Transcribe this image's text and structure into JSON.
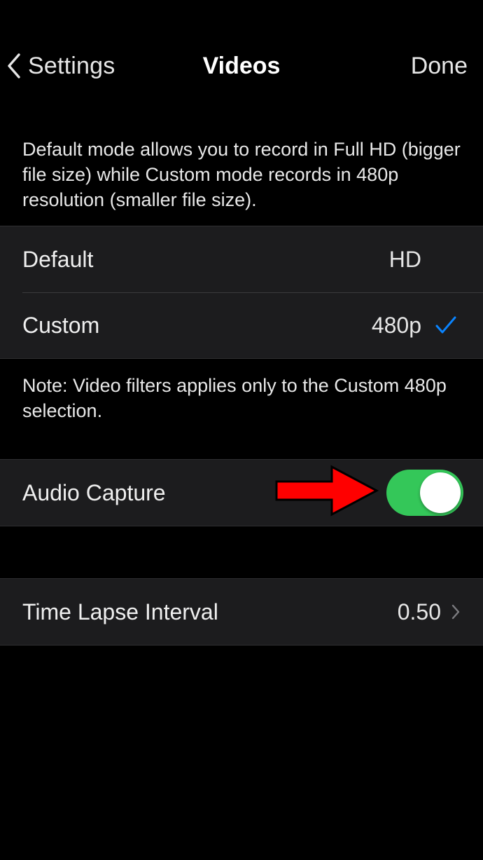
{
  "nav": {
    "back_label": "Settings",
    "title": "Videos",
    "done_label": "Done"
  },
  "description": "Default mode allows you to record in Full HD (bigger file size) while Custom mode records in 480p resolution (smaller file size).",
  "modes": [
    {
      "label": "Default",
      "value": "HD",
      "selected": false
    },
    {
      "label": "Custom",
      "value": "480p",
      "selected": true
    }
  ],
  "note": "Note: Video filters applies only to the Custom 480p selection.",
  "audio_capture": {
    "label": "Audio Capture",
    "enabled": true
  },
  "time_lapse": {
    "label": "Time Lapse Interval",
    "value": "0.50"
  },
  "icons": {
    "back": "chevron-left-icon",
    "selected": "checkmark-icon",
    "disclosure": "chevron-right-icon",
    "annotation": "red-arrow-icon"
  },
  "colors": {
    "background": "#000000",
    "cell": "#1c1c1e",
    "accent": "#0a84ff",
    "toggle_on": "#34c759",
    "annotation_arrow": "#ff0000"
  }
}
